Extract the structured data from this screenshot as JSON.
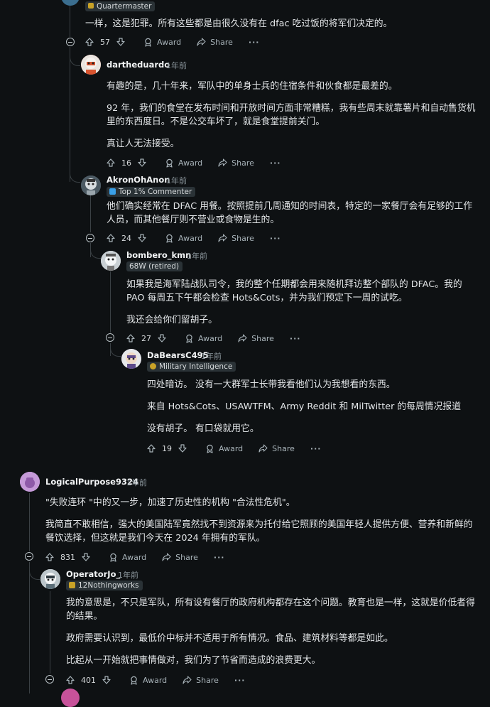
{
  "top_partial": {
    "flair": "Quartermaster",
    "body": [
      "一样，这是犯罪。所有这些都是由很久没有在 dfac 吃过饭的将军们决定的。"
    ],
    "score": "57"
  },
  "labels": {
    "award": "Award",
    "share": "Share",
    "more": "···"
  },
  "comments": [
    {
      "user": "dartheduardo",
      "time": "· 1年前",
      "flair": "",
      "body": [
        "有趣的是，几十年来，军队中的单身士兵的住宿条件和伙食都是最差的。",
        "92 年，我们的食堂在发布时间和开放时间方面非常糟糕，我有些周末就靠薯片和自动售货机里的东西度日。不是公交车坏了，就是食堂提前关门。",
        "真让人无法接受。"
      ],
      "score": "16"
    },
    {
      "user": "AkronOhAnon",
      "time": "· 1年前",
      "flair": "Top 1% Commenter",
      "body": [
        "他们确实经常在 DFAC 用餐。按照提前几周通知的时间表，特定的一家餐厅会有足够的工作人员，而其他餐厅则不营业或食物是生的。"
      ],
      "score": "24"
    },
    {
      "user": "bombero_kmn",
      "time": "· 1年前",
      "flair": "68W (retired)",
      "body": [
        "如果我是海军陆战队司令，我的整个任期都会用来随机拜访整个部队的 DFAC。我的 PAO 每周五下午都会检查 Hots&Cots，并为我们预定下一周的试吃。",
        "我还会给你们留胡子。"
      ],
      "score": "27"
    },
    {
      "user": "DaBearsC495",
      "time": "· 1年前",
      "flair": "Military Intelligence",
      "body": [
        "四处暗访。 没有一大群军士长带我看他们认为我想看的东西。",
        "来自 Hots&Cots、USAWTFM、Army Reddit 和 MilTwitter 的每周情况报道",
        "没有胡子。 有口袋就用它。"
      ],
      "score": "19"
    },
    {
      "user": "LogicalPurpose9324",
      "time": "· 1年前",
      "flair": "",
      "body": [
        "\"失败连环 \"中的又一步，加速了历史性的机构 \"合法性危机\"。",
        "我简直不敢相信，强大的美国陆军竟然找不到资源来为托付给它照顾的美国年轻人提供方便、营养和新鲜的餐饮选择，但这就是我们今天在 2024 年拥有的军队。"
      ],
      "score": "831"
    },
    {
      "user": "OperatorJo_",
      "time": "· 1年前",
      "flair": "12Nothingworks",
      "body": [
        "我的意思是，不只是军队，所有设有餐厅的政府机构都存在这个问题。教育也是一样，这就是价低者得的结果。",
        "政府需要认识到，最低价中标并不适用于所有情况。食品、建筑材料等都是如此。",
        "比起从一开始就把事情做对，我们为了节省而造成的浪费更大。"
      ],
      "score": "401"
    }
  ]
}
